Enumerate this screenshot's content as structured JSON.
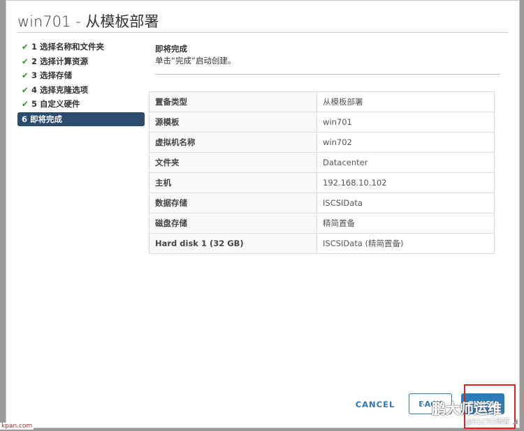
{
  "dialog": {
    "title": "win701 - 从模板部署"
  },
  "steps": [
    {
      "label": "1 选择名称和文件夹",
      "done": true
    },
    {
      "label": "2 选择计算资源",
      "done": true
    },
    {
      "label": "3 选择存储",
      "done": true
    },
    {
      "label": "4 选择克隆选项",
      "done": true
    },
    {
      "label": "5 自定义硬件",
      "done": true
    },
    {
      "label": "6 即将完成",
      "done": false,
      "active": true
    }
  ],
  "main": {
    "title": "即将完成",
    "subtitle": "单击“完成”启动创建。"
  },
  "summary": [
    {
      "key": "置备类型",
      "value": "从模板部署"
    },
    {
      "key": "源模板",
      "value": "win701"
    },
    {
      "key": "虚拟机名称",
      "value": "win702"
    },
    {
      "key": "文件夹",
      "value": "Datacenter"
    },
    {
      "key": "主机",
      "value": "192.168.10.102"
    },
    {
      "key": "数据存储",
      "value": "ISCSIData"
    },
    {
      "key": "磁盘存储",
      "value": "精简置备"
    },
    {
      "key": "Hard disk 1 (32 GB)",
      "value": "ISCSIData (精简置备)"
    }
  ],
  "buttons": {
    "cancel": "CANCEL",
    "back": "BACK",
    "finish": "FINISH"
  },
  "watermark": {
    "main": "鹏大师运维",
    "sub": "@51CTO博客",
    "left": "kpan.com"
  },
  "colors": {
    "primary": "#2c7db7",
    "active_step": "#2b4c6f",
    "check": "#3a8a2e",
    "highlight": "#e02020"
  }
}
